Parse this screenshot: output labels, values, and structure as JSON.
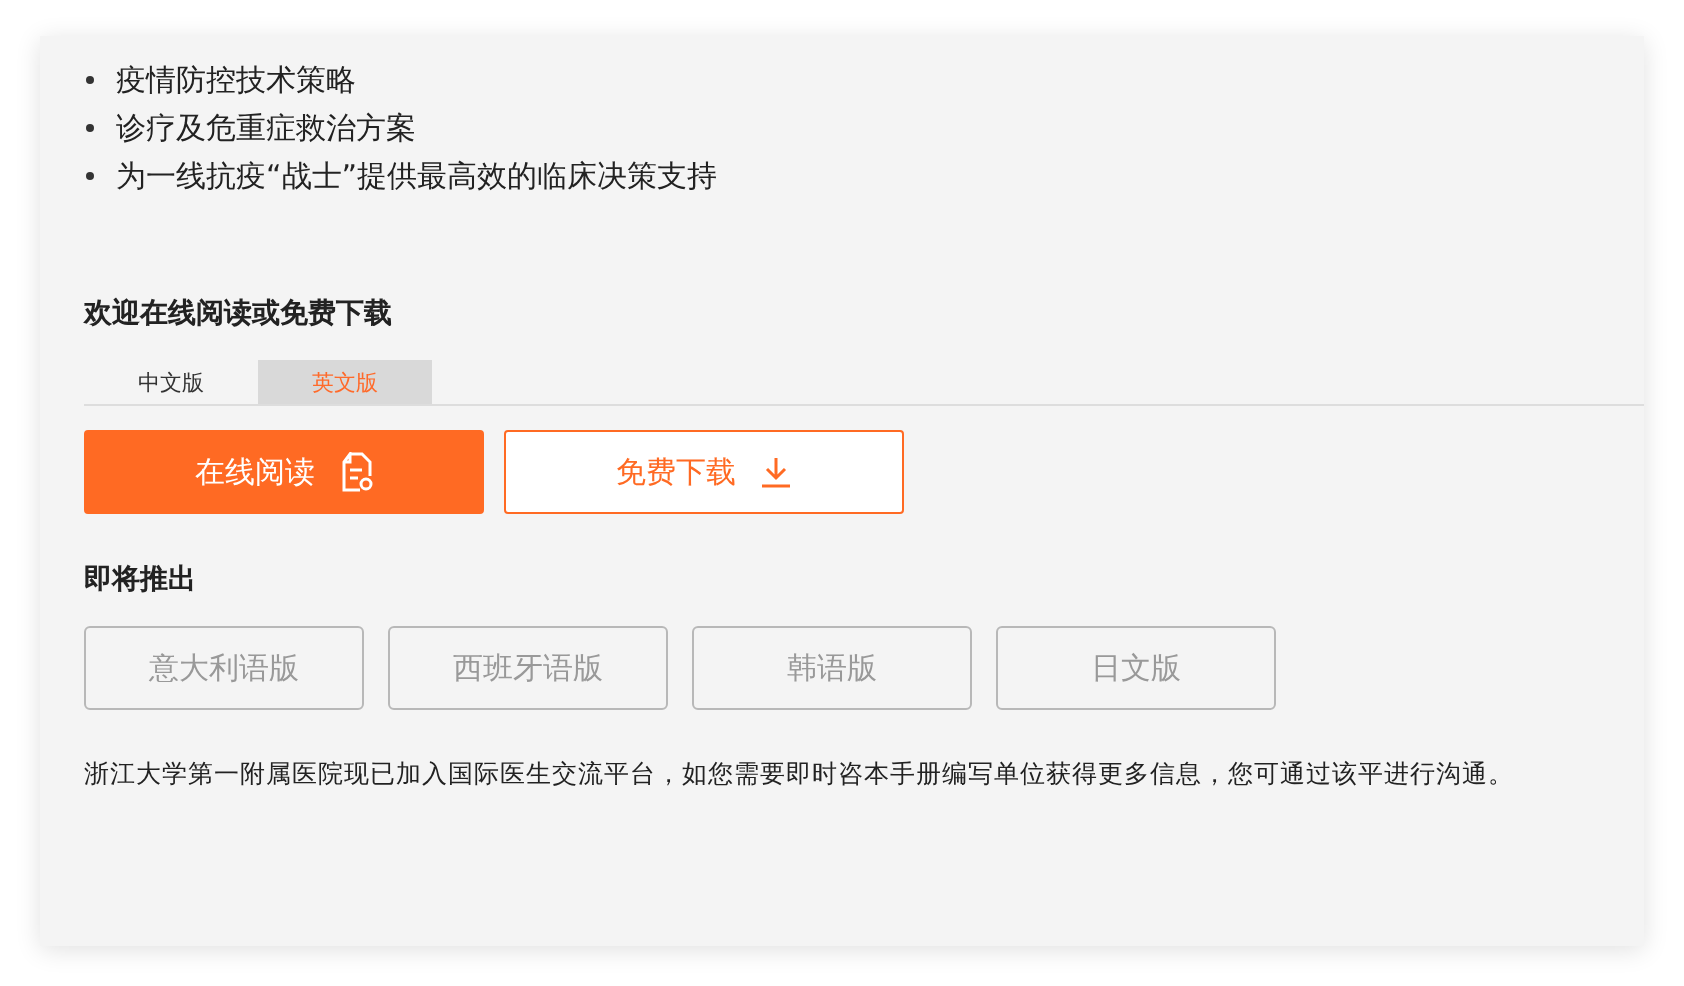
{
  "bullets": [
    "疫情防控技术策略",
    "诊疗及危重症救治方案",
    "为一线抗疫“战士”提供最高效的临床决策支持"
  ],
  "download_section": {
    "title": "欢迎在线阅读或免费下载",
    "tabs": [
      {
        "label": "中文版",
        "selected": false
      },
      {
        "label": "英文版",
        "selected": true
      }
    ],
    "actions": [
      {
        "label": "在线阅读",
        "kind": "primary"
      },
      {
        "label": "免费下载",
        "kind": "outline"
      }
    ]
  },
  "coming_soon": {
    "title": "即将推出",
    "buttons": [
      {
        "label": "意大利语版",
        "disabled": true
      },
      {
        "label": "西班牙语版",
        "disabled": true
      },
      {
        "label": "韩语版",
        "disabled": true
      },
      {
        "label": "日文版",
        "disabled": true
      }
    ]
  },
  "footer_note": "浙江大学第一附属医院现已加入国际医生交流平台，如您需要即时咨本手册编写单位获得更多信息，您可通过该平进行沟通。"
}
